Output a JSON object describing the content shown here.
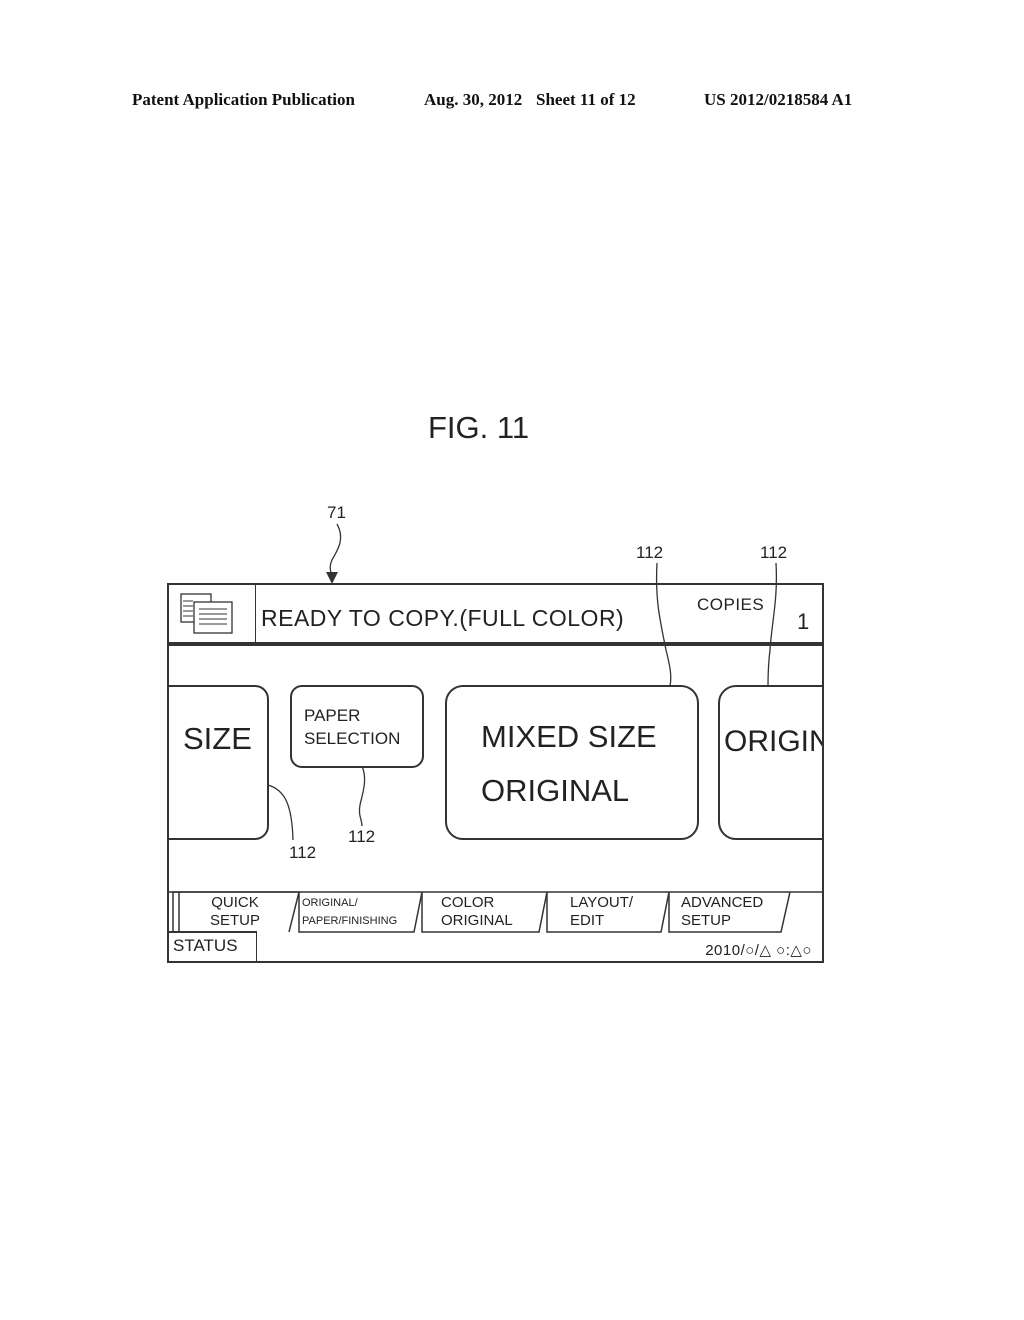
{
  "page_header": {
    "publication": "Patent Application Publication",
    "date": "Aug. 30, 2012",
    "sheet": "Sheet 11 of 12",
    "patent_number": "US 2012/0218584 A1"
  },
  "figure": {
    "title": "FIG. 11",
    "reference_numerals": {
      "panel": "71",
      "buttons": [
        "112",
        "112",
        "112",
        "112"
      ]
    }
  },
  "panel": {
    "icon": "copy-documents-icon",
    "status_message": "READY TO COPY.(FULL COLOR)",
    "copies_label": "COPIES",
    "copies_value": "1",
    "buttons": [
      {
        "label": "SIZE"
      },
      {
        "label_line1": "PAPER",
        "label_line2": "SELECTION"
      },
      {
        "label_line1": "MIXED SIZE",
        "label_line2": "ORIGINAL"
      },
      {
        "label": "ORIGIN"
      }
    ],
    "tabs": [
      {
        "line1": "QUICK",
        "line2": "SETUP"
      },
      {
        "line1": "ORIGINAL/",
        "line2": "PAPER/FINISHING"
      },
      {
        "line1": "COLOR",
        "line2": "ORIGINAL"
      },
      {
        "line1": "LAYOUT/",
        "line2": "EDIT"
      },
      {
        "line1": "ADVANCED",
        "line2": "SETUP"
      }
    ],
    "status_button": "STATUS",
    "datetime": "2010/○/△ ○:△○"
  }
}
